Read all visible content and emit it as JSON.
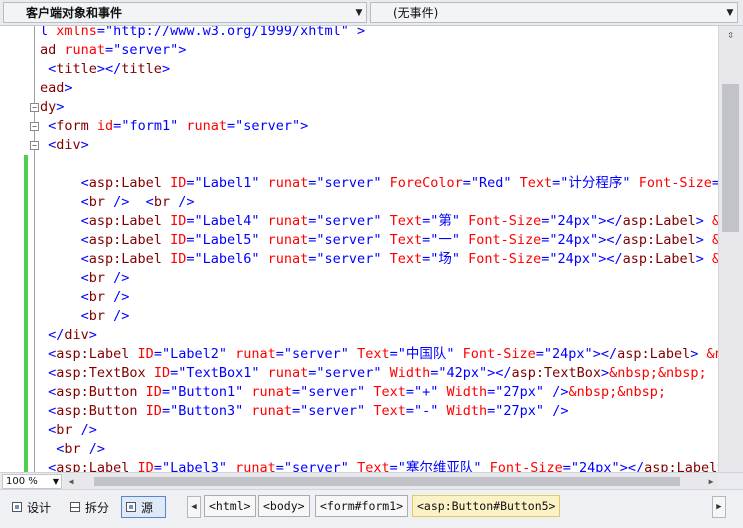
{
  "top_bar": {
    "object_combo": "客户端对象和事件",
    "event_combo": "(无事件)"
  },
  "source_lines": [
    [
      [
        "p",
        "l "
      ],
      [
        "a",
        "xmlns"
      ],
      [
        "p",
        "="
      ],
      [
        "v",
        "\"http://www.w3.org/1999/xhtml\""
      ],
      [
        "p",
        " >"
      ]
    ],
    [
      [
        "t",
        "ad "
      ],
      [
        "a",
        "runat"
      ],
      [
        "p",
        "="
      ],
      [
        "v",
        "\"server\""
      ],
      [
        "p",
        ">"
      ]
    ],
    [
      [
        "p",
        " <"
      ],
      [
        "t",
        "title"
      ],
      [
        "p",
        "></"
      ],
      [
        "t",
        "title"
      ],
      [
        "p",
        ">"
      ]
    ],
    [
      [
        "t",
        "ead"
      ],
      [
        "p",
        ">"
      ]
    ],
    [
      [
        "t",
        "dy"
      ],
      [
        "p",
        ">"
      ]
    ],
    [
      [
        "p",
        " <"
      ],
      [
        "t",
        "form "
      ],
      [
        "a",
        "id"
      ],
      [
        "p",
        "="
      ],
      [
        "v",
        "\"form1\""
      ],
      [
        "a",
        " runat"
      ],
      [
        "p",
        "="
      ],
      [
        "v",
        "\"server\""
      ],
      [
        "p",
        ">"
      ]
    ],
    [
      [
        "p",
        " <"
      ],
      [
        "t",
        "div"
      ],
      [
        "p",
        ">"
      ]
    ],
    [
      [
        "c",
        ""
      ]
    ],
    [
      [
        "p",
        "     <"
      ],
      [
        "t",
        "asp:Label "
      ],
      [
        "a",
        "ID"
      ],
      [
        "p",
        "="
      ],
      [
        "v",
        "\"Label1\""
      ],
      [
        "a",
        " runat"
      ],
      [
        "p",
        "="
      ],
      [
        "v",
        "\"server\""
      ],
      [
        "a",
        " ForeColor"
      ],
      [
        "p",
        "="
      ],
      [
        "v",
        "\"Red\""
      ],
      [
        "a",
        " Text"
      ],
      [
        "p",
        "="
      ],
      [
        "v",
        "\"计分程序\""
      ],
      [
        "a",
        " Font-Size"
      ],
      [
        "p",
        "=\""
      ]
    ],
    [
      [
        "p",
        "     <"
      ],
      [
        "t",
        "br "
      ],
      [
        "p",
        "/>  <"
      ],
      [
        "t",
        "br "
      ],
      [
        "p",
        "/>"
      ]
    ],
    [
      [
        "p",
        "     <"
      ],
      [
        "t",
        "asp:Label "
      ],
      [
        "a",
        "ID"
      ],
      [
        "p",
        "="
      ],
      [
        "v",
        "\"Label4\""
      ],
      [
        "a",
        " runat"
      ],
      [
        "p",
        "="
      ],
      [
        "v",
        "\"server\""
      ],
      [
        "a",
        " Text"
      ],
      [
        "p",
        "="
      ],
      [
        "v",
        "\"第\""
      ],
      [
        "a",
        " Font-Size"
      ],
      [
        "p",
        "="
      ],
      [
        "v",
        "\"24px\""
      ],
      [
        "p",
        "></"
      ],
      [
        "t",
        "asp:Label"
      ],
      [
        "p",
        "> "
      ],
      [
        "a",
        "&nb"
      ]
    ],
    [
      [
        "p",
        "     <"
      ],
      [
        "t",
        "asp:Label "
      ],
      [
        "a",
        "ID"
      ],
      [
        "p",
        "="
      ],
      [
        "v",
        "\"Label5\""
      ],
      [
        "a",
        " runat"
      ],
      [
        "p",
        "="
      ],
      [
        "v",
        "\"server\""
      ],
      [
        "a",
        " Text"
      ],
      [
        "p",
        "="
      ],
      [
        "v",
        "\"一\""
      ],
      [
        "a",
        " Font-Size"
      ],
      [
        "p",
        "="
      ],
      [
        "v",
        "\"24px\""
      ],
      [
        "p",
        "></"
      ],
      [
        "t",
        "asp:Label"
      ],
      [
        "p",
        "> "
      ],
      [
        "a",
        "&nb"
      ]
    ],
    [
      [
        "p",
        "     <"
      ],
      [
        "t",
        "asp:Label "
      ],
      [
        "a",
        "ID"
      ],
      [
        "p",
        "="
      ],
      [
        "v",
        "\"Label6\""
      ],
      [
        "a",
        " runat"
      ],
      [
        "p",
        "="
      ],
      [
        "v",
        "\"server\""
      ],
      [
        "a",
        " Text"
      ],
      [
        "p",
        "="
      ],
      [
        "v",
        "\"场\""
      ],
      [
        "a",
        " Font-Size"
      ],
      [
        "p",
        "="
      ],
      [
        "v",
        "\"24px\""
      ],
      [
        "p",
        "></"
      ],
      [
        "t",
        "asp:Label"
      ],
      [
        "p",
        "> "
      ],
      [
        "a",
        "&nb"
      ]
    ],
    [
      [
        "p",
        "     <"
      ],
      [
        "t",
        "br "
      ],
      [
        "p",
        "/>"
      ]
    ],
    [
      [
        "p",
        "     <"
      ],
      [
        "t",
        "br "
      ],
      [
        "p",
        "/>"
      ]
    ],
    [
      [
        "p",
        "     <"
      ],
      [
        "t",
        "br "
      ],
      [
        "p",
        "/>"
      ]
    ],
    [
      [
        "p",
        " </"
      ],
      [
        "t",
        "div"
      ],
      [
        "p",
        ">"
      ]
    ],
    [
      [
        "p",
        " <"
      ],
      [
        "t",
        "asp:Label "
      ],
      [
        "a",
        "ID"
      ],
      [
        "p",
        "="
      ],
      [
        "v",
        "\"Label2\""
      ],
      [
        "a",
        " runat"
      ],
      [
        "p",
        "="
      ],
      [
        "v",
        "\"server\""
      ],
      [
        "a",
        " Text"
      ],
      [
        "p",
        "="
      ],
      [
        "v",
        "\"中国队\""
      ],
      [
        "a",
        " Font-Size"
      ],
      [
        "p",
        "="
      ],
      [
        "v",
        "\"24px\""
      ],
      [
        "p",
        "></"
      ],
      [
        "t",
        "asp:Label"
      ],
      [
        "p",
        "> "
      ],
      [
        "a",
        "&nb"
      ]
    ],
    [
      [
        "p",
        " <"
      ],
      [
        "t",
        "asp:TextBox "
      ],
      [
        "a",
        "ID"
      ],
      [
        "p",
        "="
      ],
      [
        "v",
        "\"TextBox1\""
      ],
      [
        "a",
        " runat"
      ],
      [
        "p",
        "="
      ],
      [
        "v",
        "\"server\""
      ],
      [
        "a",
        " Width"
      ],
      [
        "p",
        "="
      ],
      [
        "v",
        "\"42px\""
      ],
      [
        "p",
        "></"
      ],
      [
        "t",
        "asp:TextBox"
      ],
      [
        "p",
        ">"
      ],
      [
        "a",
        "&nbsp;&nbsp;"
      ]
    ],
    [
      [
        "p",
        " <"
      ],
      [
        "t",
        "asp:Button "
      ],
      [
        "a",
        "ID"
      ],
      [
        "p",
        "="
      ],
      [
        "v",
        "\"Button1\""
      ],
      [
        "a",
        " runat"
      ],
      [
        "p",
        "="
      ],
      [
        "v",
        "\"server\""
      ],
      [
        "a",
        " Text"
      ],
      [
        "p",
        "="
      ],
      [
        "v",
        "\"+\""
      ],
      [
        "a",
        " Width"
      ],
      [
        "p",
        "="
      ],
      [
        "v",
        "\"27px\""
      ],
      [
        "p",
        " />"
      ],
      [
        "a",
        "&nbsp;&nbsp;"
      ]
    ],
    [
      [
        "p",
        " <"
      ],
      [
        "t",
        "asp:Button "
      ],
      [
        "a",
        "ID"
      ],
      [
        "p",
        "="
      ],
      [
        "v",
        "\"Button3\""
      ],
      [
        "a",
        " runat"
      ],
      [
        "p",
        "="
      ],
      [
        "v",
        "\"server\""
      ],
      [
        "a",
        " Text"
      ],
      [
        "p",
        "="
      ],
      [
        "v",
        "\"-\""
      ],
      [
        "a",
        " Width"
      ],
      [
        "p",
        "="
      ],
      [
        "v",
        "\"27px\""
      ],
      [
        "p",
        " />"
      ]
    ],
    [
      [
        "p",
        " <"
      ],
      [
        "t",
        "br "
      ],
      [
        "p",
        "/>"
      ]
    ],
    [
      [
        "p",
        "  <"
      ],
      [
        "t",
        "br "
      ],
      [
        "p",
        "/>"
      ]
    ],
    [
      [
        "p",
        " <"
      ],
      [
        "t",
        "asp:Label "
      ],
      [
        "a",
        "ID"
      ],
      [
        "p",
        "="
      ],
      [
        "v",
        "\"Label3\""
      ],
      [
        "a",
        " runat"
      ],
      [
        "p",
        "="
      ],
      [
        "v",
        "\"server\""
      ],
      [
        "a",
        " Text"
      ],
      [
        "p",
        "="
      ],
      [
        "v",
        "\"塞尔维亚队\""
      ],
      [
        "a",
        " Font-Size"
      ],
      [
        "p",
        "="
      ],
      [
        "v",
        "\"24px\""
      ],
      [
        "p",
        "></"
      ],
      [
        "t",
        "asp:Label"
      ],
      [
        "p",
        ">"
      ]
    ]
  ],
  "fold_markers": [
    {
      "line": 0,
      "symbol": ""
    },
    {
      "line": 4,
      "symbol": "−"
    },
    {
      "line": 5,
      "symbol": "−"
    },
    {
      "line": 6,
      "symbol": "−"
    }
  ],
  "status": {
    "zoom": "100 %"
  },
  "view_tabs": {
    "design": "设计",
    "split": "拆分",
    "source": "源"
  },
  "breadcrumb": {
    "items": [
      "<html>",
      "<body>",
      "<form#form1>",
      "<asp:Button#Button5>"
    ]
  }
}
